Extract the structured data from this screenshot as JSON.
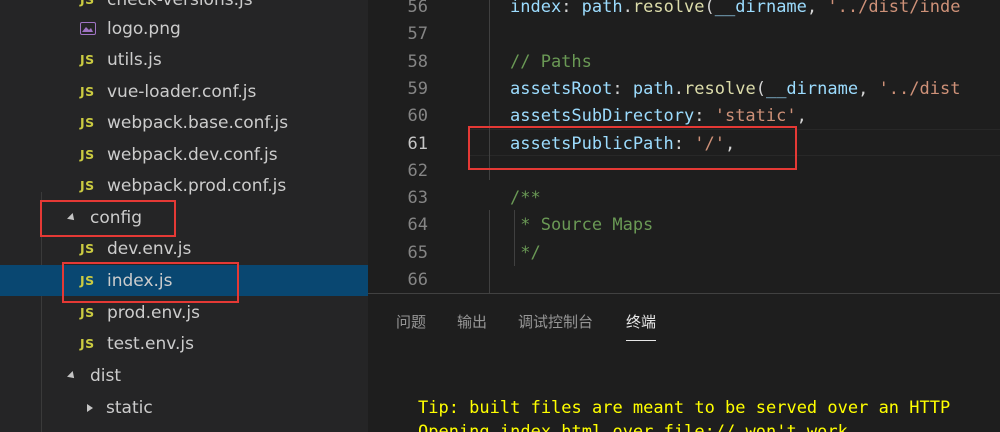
{
  "explorer": {
    "items": [
      {
        "kind": "js",
        "label": "check-versions.js"
      },
      {
        "kind": "image",
        "label": "logo.png"
      },
      {
        "kind": "js",
        "label": "utils.js"
      },
      {
        "kind": "js",
        "label": "vue-loader.conf.js"
      },
      {
        "kind": "js",
        "label": "webpack.base.conf.js"
      },
      {
        "kind": "js",
        "label": "webpack.dev.conf.js"
      },
      {
        "kind": "js",
        "label": "webpack.prod.conf.js"
      },
      {
        "kind": "folder-open",
        "label": "config"
      },
      {
        "kind": "js",
        "label": "dev.env.js"
      },
      {
        "kind": "js",
        "label": "index.js",
        "selected": true
      },
      {
        "kind": "js",
        "label": "prod.env.js"
      },
      {
        "kind": "js",
        "label": "test.env.js"
      },
      {
        "kind": "folder-open",
        "label": "dist"
      },
      {
        "kind": "folder-closed",
        "label": "static"
      }
    ],
    "js_badge": "JS"
  },
  "editor": {
    "active_line": "61",
    "lines": [
      {
        "num": "56",
        "tokens": [
          [
            "prop",
            "index"
          ],
          [
            "punc",
            ": "
          ],
          [
            "prop",
            "path"
          ],
          [
            "punc",
            "."
          ],
          [
            "fn",
            "resolve"
          ],
          [
            "punc",
            "("
          ],
          [
            "prop",
            "__dirname"
          ],
          [
            "punc",
            ", "
          ],
          [
            "str",
            "'../dist/inde"
          ]
        ]
      },
      {
        "num": "57",
        "tokens": []
      },
      {
        "num": "58",
        "tokens": [
          [
            "cmt",
            "// Paths"
          ]
        ]
      },
      {
        "num": "59",
        "tokens": [
          [
            "prop",
            "assetsRoot"
          ],
          [
            "punc",
            ": "
          ],
          [
            "prop",
            "path"
          ],
          [
            "punc",
            "."
          ],
          [
            "fn",
            "resolve"
          ],
          [
            "punc",
            "("
          ],
          [
            "prop",
            "__dirname"
          ],
          [
            "punc",
            ", "
          ],
          [
            "str",
            "'../dist"
          ]
        ]
      },
      {
        "num": "60",
        "tokens": [
          [
            "prop",
            "assetsSubDirectory"
          ],
          [
            "punc",
            ": "
          ],
          [
            "str",
            "'static'"
          ],
          [
            "punc",
            ","
          ]
        ]
      },
      {
        "num": "61",
        "tokens": [
          [
            "prop",
            "assetsPublicPath"
          ],
          [
            "punc",
            ": "
          ],
          [
            "str",
            "'/'"
          ],
          [
            "punc",
            ","
          ]
        ]
      },
      {
        "num": "62",
        "tokens": []
      },
      {
        "num": "63",
        "tokens": [
          [
            "cmt",
            "/**"
          ]
        ]
      },
      {
        "num": "64",
        "tokens": [
          [
            "cmt",
            " * Source Maps"
          ]
        ]
      },
      {
        "num": "65",
        "tokens": [
          [
            "cmt",
            " */"
          ]
        ]
      },
      {
        "num": "66",
        "tokens": []
      }
    ]
  },
  "panel": {
    "tabs": [
      {
        "label": "问题",
        "active": false
      },
      {
        "label": "输出",
        "active": false
      },
      {
        "label": "调试控制台",
        "active": false
      },
      {
        "label": "终端",
        "active": true
      }
    ],
    "terminal_lines": [
      "Tip: built files are meant to be served over an HTTP",
      "Opening index.html over file:// won't work."
    ]
  },
  "colors": {
    "annotation": "#e53935",
    "selection": "#094771",
    "terminal_text": "#ffff00",
    "js_icon": "#cbcb41"
  }
}
